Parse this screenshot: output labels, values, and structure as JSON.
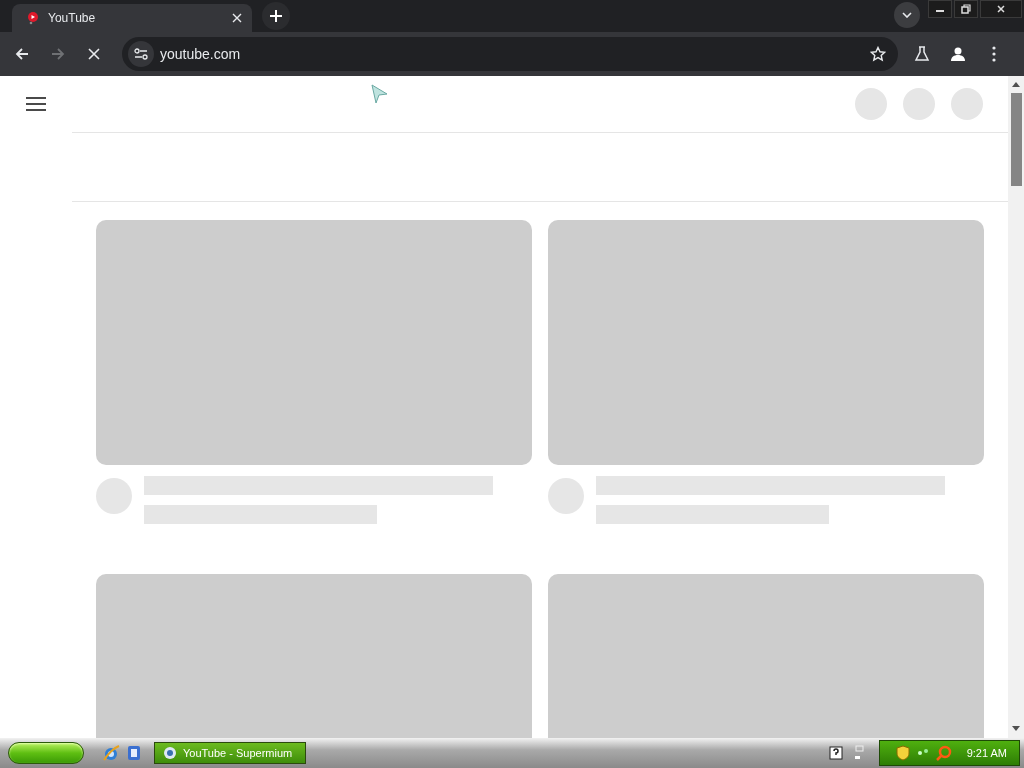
{
  "browser": {
    "tab": {
      "title": "YouTube",
      "selected": true
    },
    "address": "youtube.com",
    "loading": true
  },
  "page": {
    "video_placeholders": [
      {
        "kind": "video"
      },
      {
        "kind": "video"
      },
      {
        "kind": "video-thumbnail"
      },
      {
        "kind": "video-thumbnail"
      }
    ]
  },
  "taskbar": {
    "tasks": [
      {
        "label": "YouTube - Supermium",
        "selected": true
      }
    ],
    "clock": "9:21 AM"
  }
}
